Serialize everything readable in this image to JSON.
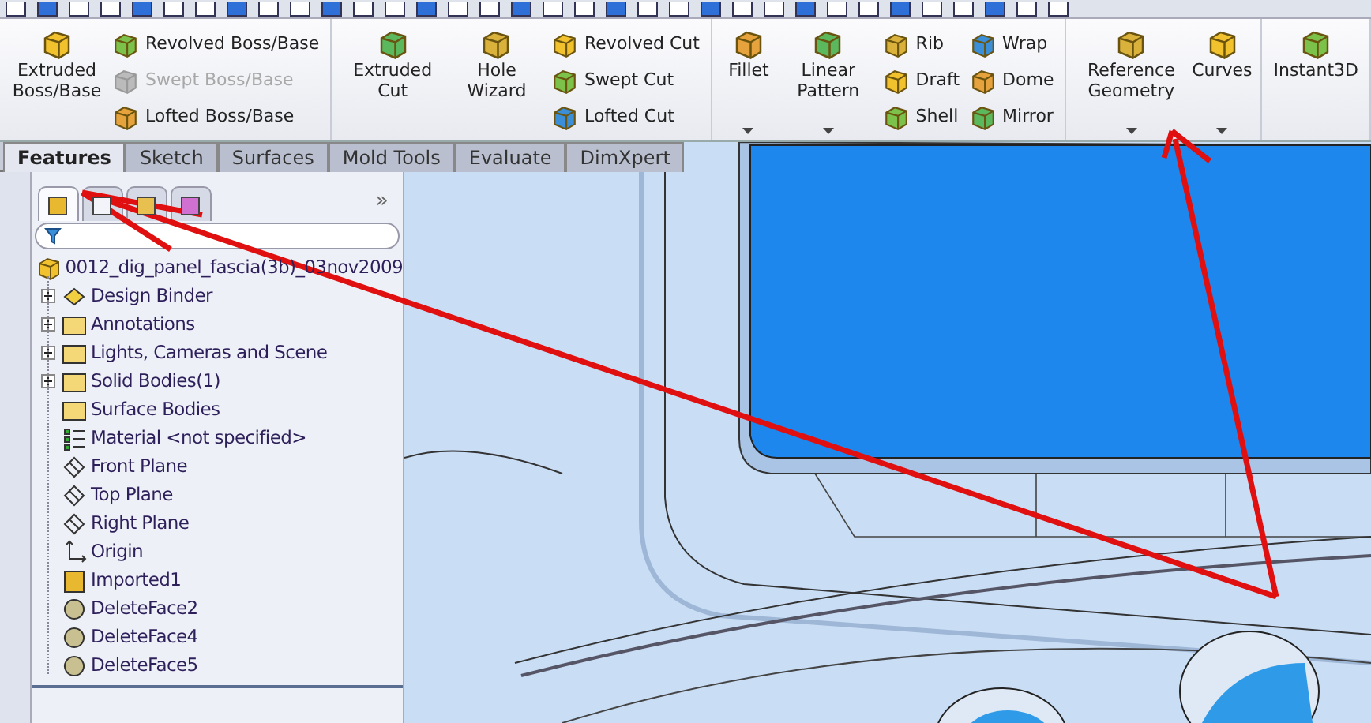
{
  "ribbon": {
    "groups": [
      {
        "large": [
          {
            "label": "Extruded Boss/Base",
            "dropdown": false
          }
        ],
        "columns": [
          [
            {
              "label": "Revolved Boss/Base",
              "disabled": false
            },
            {
              "label": "Swept Boss/Base",
              "disabled": true
            },
            {
              "label": "Lofted Boss/Base",
              "disabled": false
            }
          ]
        ]
      },
      {
        "large": [
          {
            "label": "Extruded Cut",
            "dropdown": false
          },
          {
            "label": "Hole Wizard",
            "dropdown": false
          }
        ],
        "columns": [
          [
            {
              "label": "Revolved Cut",
              "disabled": false
            },
            {
              "label": "Swept Cut",
              "disabled": false
            },
            {
              "label": "Lofted Cut",
              "disabled": false
            }
          ]
        ]
      },
      {
        "large": [
          {
            "label": "Fillet",
            "dropdown": true
          },
          {
            "label": "Linear Pattern",
            "dropdown": true
          }
        ],
        "columns": [
          [
            {
              "label": "Rib",
              "disabled": false
            },
            {
              "label": "Draft",
              "disabled": false
            },
            {
              "label": "Shell",
              "disabled": false
            }
          ],
          [
            {
              "label": "Wrap",
              "disabled": false
            },
            {
              "label": "Dome",
              "disabled": false
            },
            {
              "label": "Mirror",
              "disabled": false
            }
          ]
        ]
      },
      {
        "large": [
          {
            "label": "Reference Geometry",
            "dropdown": true
          },
          {
            "label": "Curves",
            "dropdown": true
          }
        ]
      },
      {
        "large": [
          {
            "label": "Instant3D",
            "dropdown": false
          }
        ]
      }
    ]
  },
  "tabs": [
    {
      "label": "Features",
      "selected": true
    },
    {
      "label": "Sketch",
      "selected": false
    },
    {
      "label": "Surfaces",
      "selected": false
    },
    {
      "label": "Mold Tools",
      "selected": false
    },
    {
      "label": "Evaluate",
      "selected": false
    },
    {
      "label": "DimXpert",
      "selected": false
    }
  ],
  "panel": {
    "tabs": [
      {
        "selected": true
      },
      {
        "selected": false
      },
      {
        "selected": false
      },
      {
        "selected": false
      }
    ],
    "more": "»",
    "tree": {
      "root": "0012_dig_panel_fascia(3b)_03nov2009",
      "items": [
        {
          "label": "Design Binder",
          "kind": "binder",
          "expandable": true
        },
        {
          "label": "Annotations",
          "kind": "annotations",
          "expandable": true
        },
        {
          "label": "Lights, Cameras and Scene",
          "kind": "lights",
          "expandable": true
        },
        {
          "label": "Solid Bodies(1)",
          "kind": "bodies",
          "expandable": true
        },
        {
          "label": "Surface Bodies",
          "kind": "surfaces",
          "expandable": false
        },
        {
          "label": "Material <not specified>",
          "kind": "material",
          "expandable": false
        },
        {
          "label": "Front Plane",
          "kind": "plane",
          "expandable": false
        },
        {
          "label": "Top Plane",
          "kind": "plane",
          "expandable": false
        },
        {
          "label": "Right Plane",
          "kind": "plane",
          "expandable": false
        },
        {
          "label": "Origin",
          "kind": "origin",
          "expandable": false
        },
        {
          "label": "Imported1",
          "kind": "imported",
          "expandable": false
        },
        {
          "label": "DeleteFace2",
          "kind": "deleteface",
          "expandable": false
        },
        {
          "label": "DeleteFace4",
          "kind": "deleteface",
          "expandable": false
        },
        {
          "label": "DeleteFace5",
          "kind": "deleteface",
          "expandable": false
        }
      ]
    }
  }
}
